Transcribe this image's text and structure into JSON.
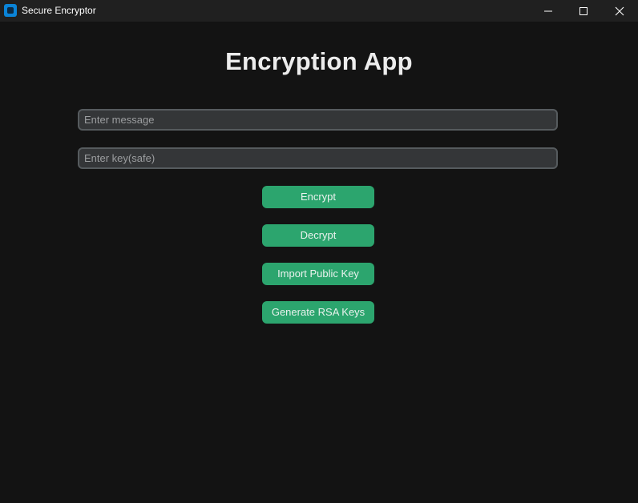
{
  "window": {
    "title": "Secure Encryptor",
    "icon": "app-icon",
    "controls": [
      "minimize-icon",
      "maximize-icon",
      "close-icon"
    ]
  },
  "main": {
    "heading": "Encryption App",
    "message_input": {
      "value": "",
      "placeholder": "Enter message"
    },
    "key_input": {
      "value": "",
      "placeholder": "Enter key(safe)"
    },
    "buttons": {
      "encrypt": "Encrypt",
      "decrypt": "Decrypt",
      "import_public_key": "Import Public Key",
      "generate_rsa_keys": "Generate RSA Keys"
    }
  },
  "colors": {
    "background": "#131313",
    "titlebar": "#202020",
    "button_accent": "#2ca56e",
    "input_background": "#343638",
    "input_border": "#565b5e"
  }
}
